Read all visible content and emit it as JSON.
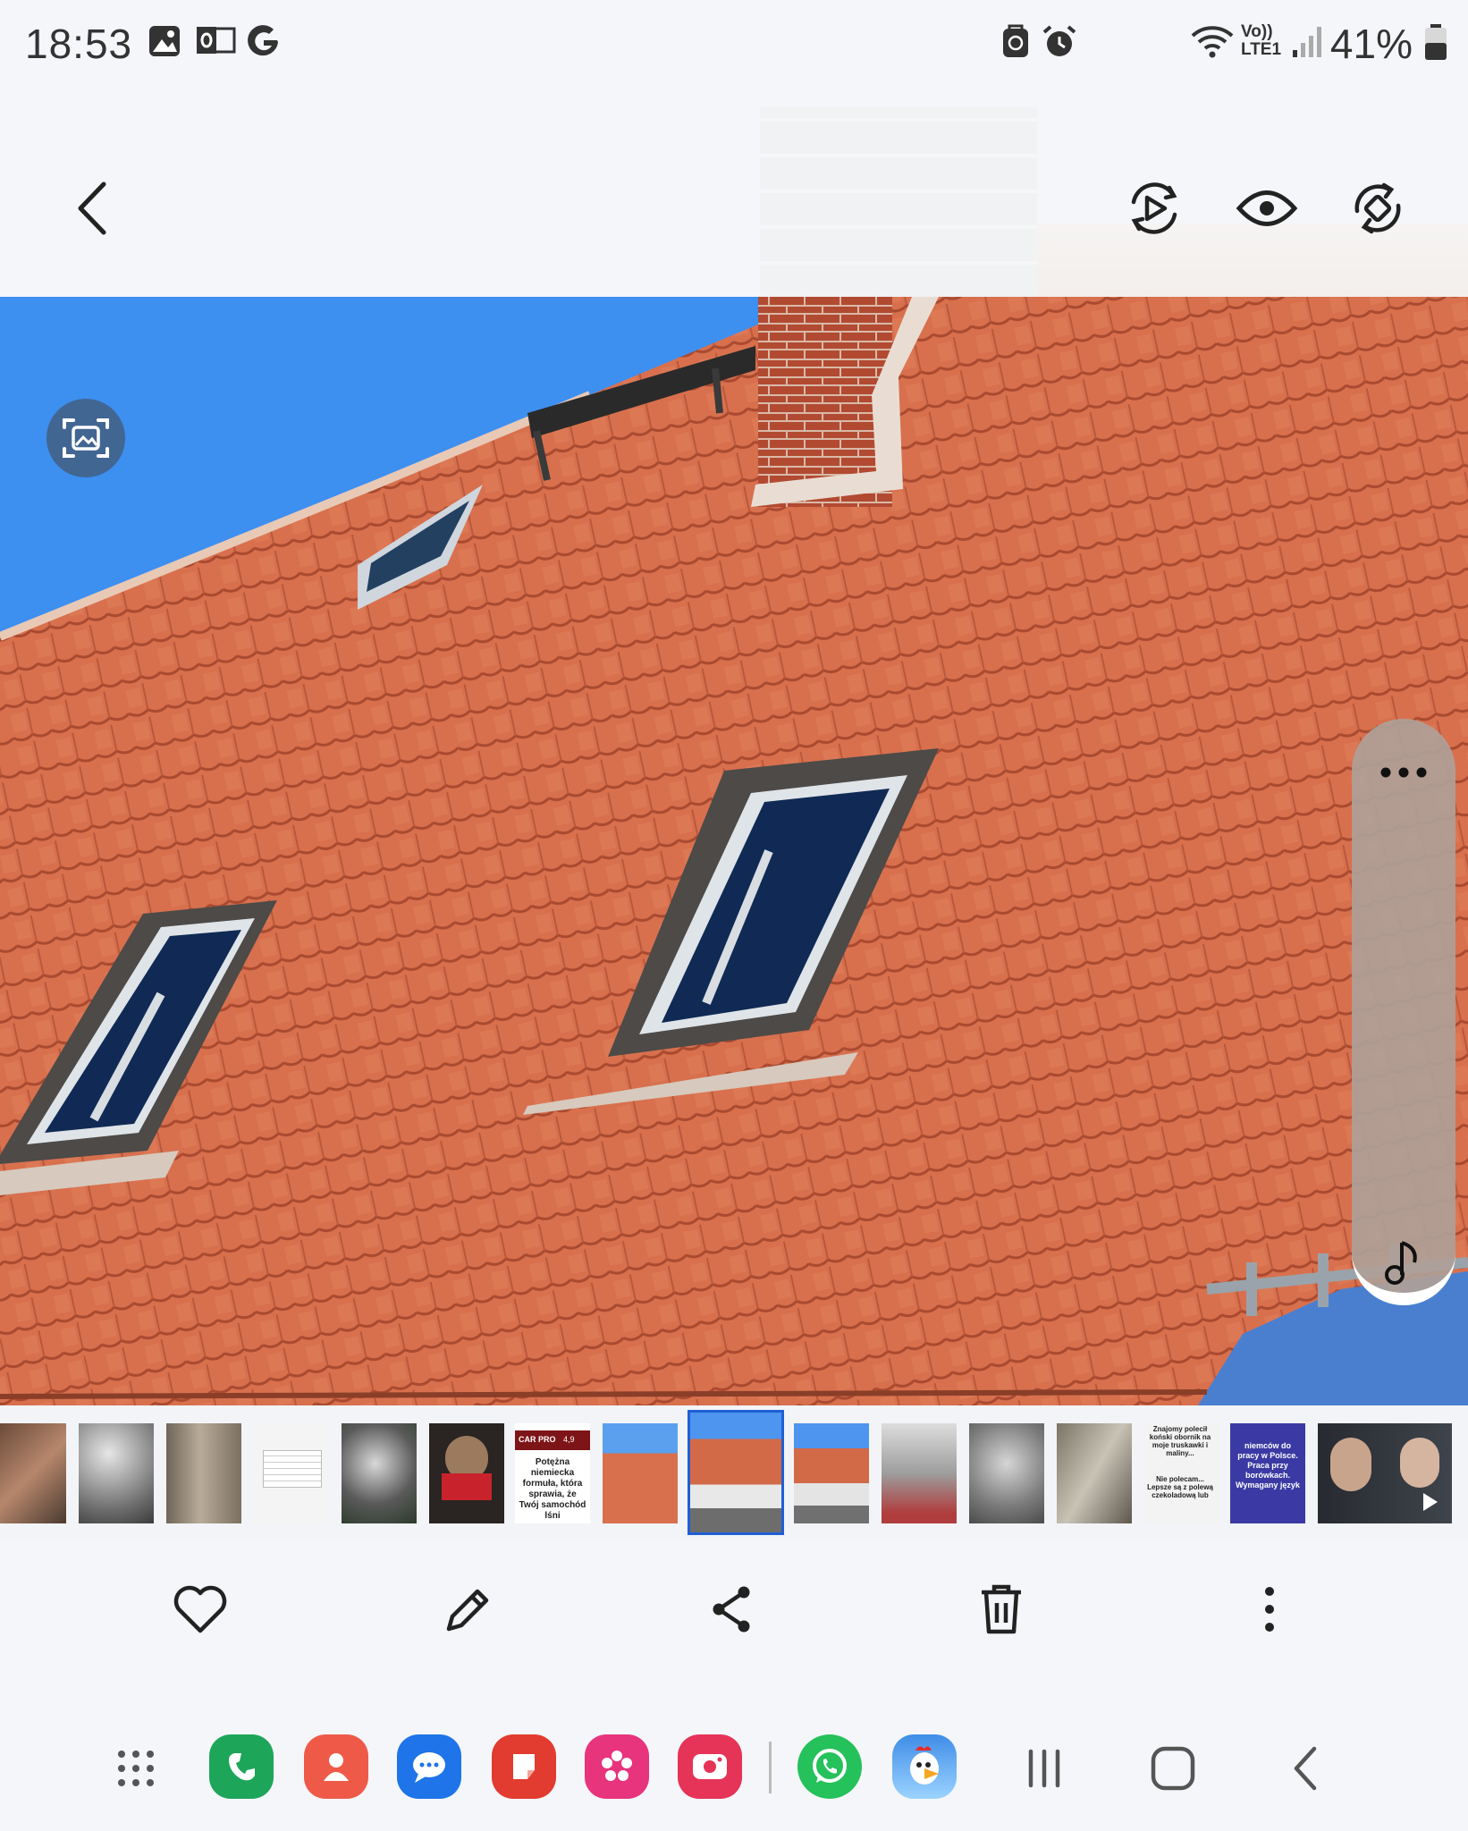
{
  "status_bar": {
    "time": "18:53",
    "icons": [
      "gallery-icon",
      "outlook-icon",
      "google-icon",
      "secure-folder-icon",
      "alarm-icon",
      "wifi-icon",
      "volte-icon",
      "signal-icon",
      "battery-icon"
    ],
    "volte_label": "Vo))",
    "lte_label": "LTE1",
    "battery": "41%"
  },
  "top_bar": {
    "icons": [
      "back-icon",
      "motion-photo-icon",
      "view-icon",
      "rotate-icon"
    ]
  },
  "photo": {
    "side_panel_icons": [
      "more-icon",
      "music-icon"
    ],
    "scan_icon": "image-scan-icon"
  },
  "filmstrip": {
    "thumb_texts": {
      "t7_badge": "CAR PRO",
      "t7_rating": "4,9",
      "t7_text": "Potężna niemiecka formuła, która sprawia, że Twój samochód lśni",
      "t14_text": "Znajomy polecił koński obornik na moje truskawki i maliny...",
      "t14_text2": "Nie polecam... Lepsze są z polewą czekoladową lub",
      "t15_text": "niemców do pracy w Polsce. Praca przy borówkach. Wymagany język"
    },
    "selected_index": 8
  },
  "action_bar": {
    "icons": [
      "favorite-icon",
      "edit-icon",
      "share-icon",
      "delete-icon",
      "more-options-icon"
    ]
  },
  "dock": {
    "apps": [
      "apps-grid-icon",
      "phone-app-icon",
      "contacts-app-icon",
      "messages-app-icon",
      "notes-app-icon",
      "bixby-app-icon",
      "screen-recorder-app-icon",
      "whatsapp-app-icon",
      "game-app-icon"
    ],
    "nav": [
      "recents-icon",
      "home-icon",
      "back-nav-icon"
    ]
  },
  "colors": {
    "accent": "#1f5fd6",
    "roof": "#d66b4a",
    "sky": "#3d8ff0"
  }
}
